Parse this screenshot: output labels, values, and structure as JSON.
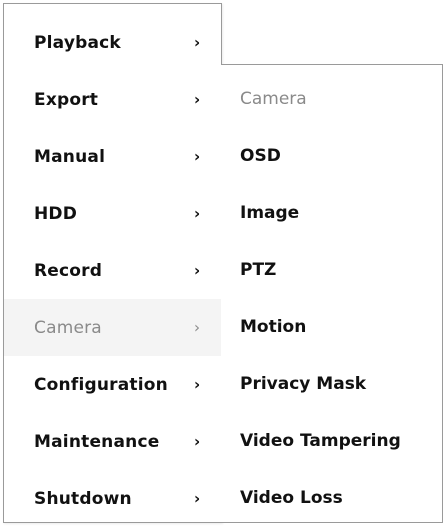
{
  "main_menu": {
    "items": [
      {
        "label": "Playback",
        "chevron": "›"
      },
      {
        "label": "Export",
        "chevron": "›"
      },
      {
        "label": "Manual",
        "chevron": "›"
      },
      {
        "label": "HDD",
        "chevron": "›"
      },
      {
        "label": "Record",
        "chevron": "›"
      },
      {
        "label": "Camera",
        "chevron": "›"
      },
      {
        "label": "Configuration",
        "chevron": "›"
      },
      {
        "label": "Maintenance",
        "chevron": "›"
      },
      {
        "label": "Shutdown",
        "chevron": "›"
      }
    ],
    "active_item": "Camera"
  },
  "sub_menu": {
    "header": "Camera",
    "items": [
      {
        "label": "OSD"
      },
      {
        "label": "Image"
      },
      {
        "label": "PTZ"
      },
      {
        "label": "Motion"
      },
      {
        "label": "Privacy Mask"
      },
      {
        "label": "Video Tampering"
      },
      {
        "label": "Video Loss"
      }
    ]
  },
  "colors": {
    "text": "#111111",
    "muted_text": "#8a8a8a",
    "border": "#9a9a9a",
    "active_bg": "#f4f4f4"
  }
}
